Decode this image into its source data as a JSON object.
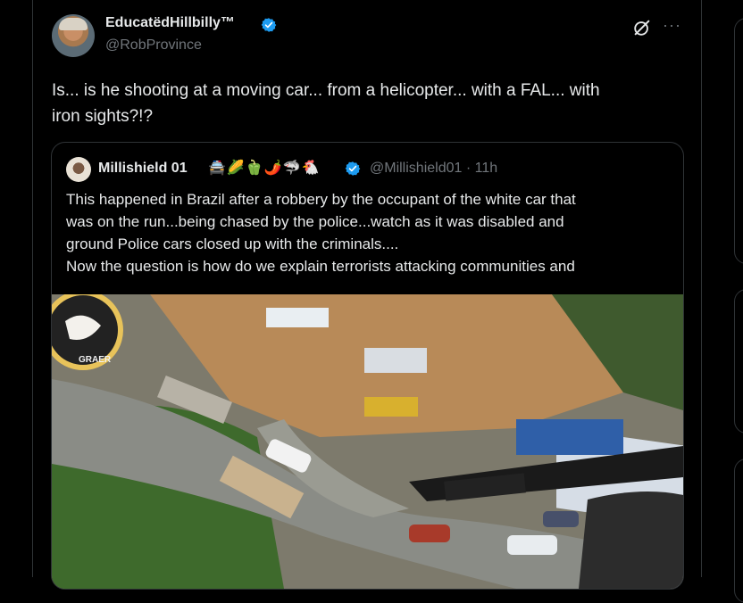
{
  "tweet": {
    "author_name": "EducatëdHillbilly™",
    "author_handle": "@RobProvince",
    "text_line1": "Is... is he shooting at a moving car... from a helicopter... with a FAL... with",
    "text_line2": "iron sights?!?",
    "more_label": "···",
    "accent_color": "#1d9bf0"
  },
  "quoted": {
    "author_name": "Millishield 01",
    "emojis": "🚔🌽🫑🌶️🦈🐔",
    "handle_time": "@Millishield01 · 11h",
    "lines": [
      "This happened in Brazil after a robbery by the occupant of the white car that",
      "was on the run...being chased by the police...watch as it was disabled and",
      "ground Police cars closed up with the criminals....",
      "Now the question is how do we explain terrorists attacking communities and"
    ],
    "media_watermark": "GRAER"
  }
}
